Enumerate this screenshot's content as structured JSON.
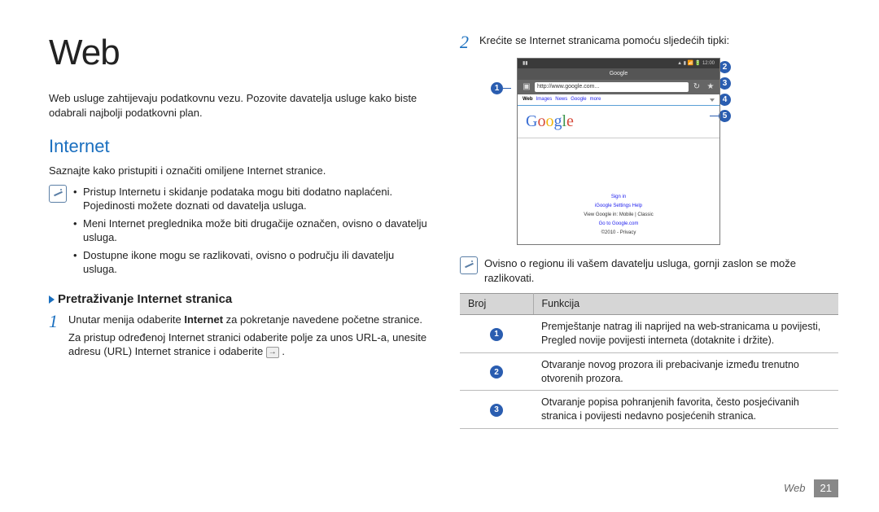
{
  "title": "Web",
  "intro": "Web usluge zahtijevaju podatkovnu vezu. Pozovite davatelja usluge kako biste odabrali najbolji podatkovni plan.",
  "section_internet": "Internet",
  "internet_intro": "Saznajte kako pristupiti i označiti omiljene Internet stranice.",
  "note_bullets": [
    "Pristup Internetu i skidanje podataka mogu biti dodatno naplaćeni. Pojedinosti možete doznati od davatelja usluga.",
    "Meni Internet preglednika može biti drugačije označen, ovisno o davatelju usluga.",
    "Dostupne ikone mogu se razlikovati, ovisno o području ili davatelju usluga."
  ],
  "subsection_browse": "Pretraživanje Internet stranica",
  "step1": {
    "main_pre": "Unutar menija odaberite ",
    "bold": "Internet",
    "main_post": " za pokretanje navedene početne stranice.",
    "sub": "Za pristup određenoj Internet stranici odaberite polje za unos URL-a, unesite adresu (URL) Internet stranice i odaberite "
  },
  "step2": "Krećite se Internet stranicama pomoću sljedećih tipki:",
  "phone": {
    "title": "Google",
    "url": "http://www.google.com...",
    "menu": {
      "web": "Web",
      "items": [
        "Images",
        "News",
        "Google",
        "more"
      ]
    },
    "logo": "Google",
    "footer_lines": [
      "Sign in",
      "iGoogle  Settings  Help",
      "View Google in: Mobile | Classic",
      "Go to Google.com",
      "©2010 - Privacy"
    ]
  },
  "note2": "Ovisno o regionu ili vašem davatelju usluga, gornji zaslon se može razlikovati.",
  "table": {
    "headers": [
      "Broj",
      "Funkcija"
    ],
    "rows": [
      "Premještanje natrag ili naprijed na web-stranicama u povijesti, Pregled novije povijesti interneta (dotaknite i držite).",
      "Otvaranje novog prozora ili prebacivanje između trenutno otvorenih prozora.",
      "Otvaranje popisa pohranjenih favorita, često posjećivanih stranica i povijesti nedavno posjećenih stranica."
    ]
  },
  "footer": {
    "section": "Web",
    "page": "21"
  }
}
